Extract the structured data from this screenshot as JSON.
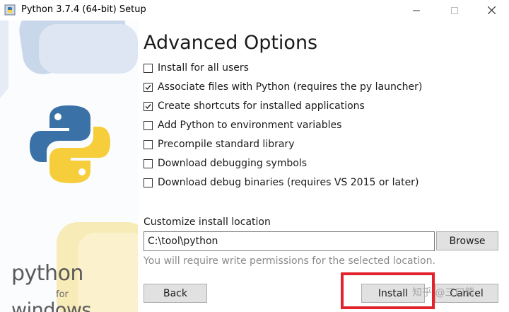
{
  "window": {
    "title": "Python 3.7.4 (64-bit) Setup",
    "icon": "python-setup-icon",
    "controls": [
      "minimize-icon",
      "maximize-icon",
      "close-icon"
    ]
  },
  "brand": {
    "line1": "python",
    "line2": "for",
    "line3": "windows",
    "logo_colors": [
      "#3776ab",
      "#ffd43b"
    ]
  },
  "main": {
    "heading": "Advanced Options",
    "options": [
      {
        "label": "Install for all users",
        "checked": false
      },
      {
        "label": "Associate files with Python (requires the py launcher)",
        "checked": true
      },
      {
        "label": "Create shortcuts for installed applications",
        "checked": true
      },
      {
        "label": "Add Python to environment variables",
        "checked": false
      },
      {
        "label": "Precompile standard library",
        "checked": false
      },
      {
        "label": "Download debugging symbols",
        "checked": false
      },
      {
        "label": "Download debug binaries (requires VS 2015 or later)",
        "checked": false
      }
    ],
    "location": {
      "label": "Customize install location",
      "value": "C:\\tool\\python",
      "browse_label": "Browse",
      "note": "You will require write permissions for the selected location."
    }
  },
  "footer": {
    "back_label": "Back",
    "install_label": "Install",
    "cancel_label": "Cancel",
    "highlight_color": "#e3232c"
  },
  "watermark": "知乎 @三口熊"
}
